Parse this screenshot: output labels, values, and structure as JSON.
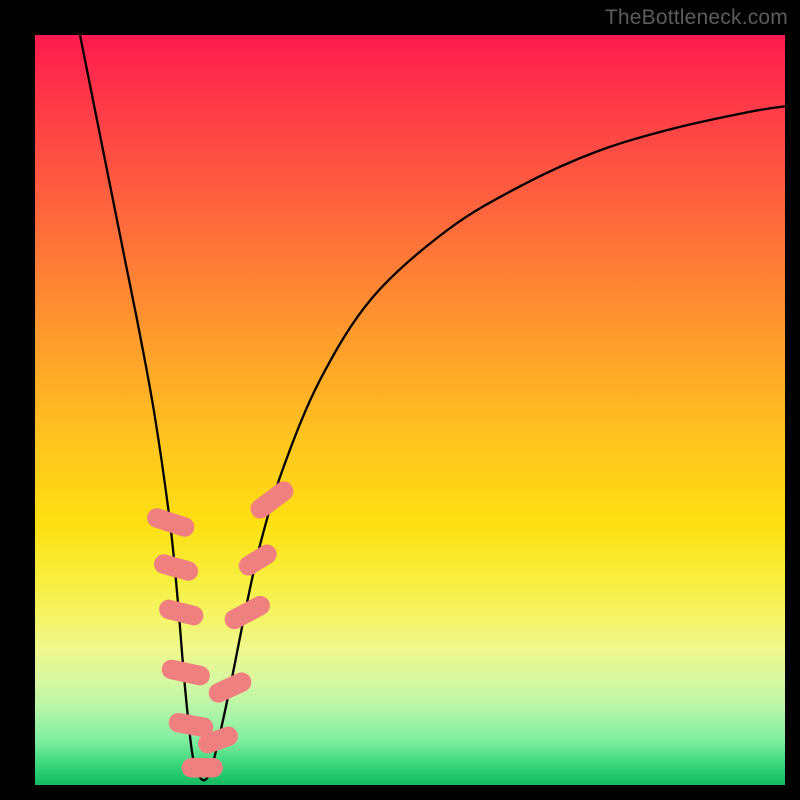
{
  "watermark": "TheBottleneck.com",
  "colors": {
    "background": "#000000",
    "curve": "#000000",
    "marker": "#f08080"
  },
  "chart_data": {
    "type": "line",
    "title": "",
    "xlabel": "",
    "ylabel": "",
    "xlim": [
      0,
      100
    ],
    "ylim": [
      0,
      100
    ],
    "series": [
      {
        "name": "bottleneck-curve",
        "x": [
          6,
          8,
          10,
          12,
          14,
          16,
          18,
          19,
          20,
          21,
          22,
          23,
          24,
          26,
          28,
          30,
          33,
          38,
          45,
          55,
          65,
          75,
          85,
          95,
          100
        ],
        "y": [
          100,
          90,
          80,
          70,
          60,
          49,
          35,
          25,
          13,
          4,
          1,
          1,
          4,
          13,
          23,
          32,
          42,
          54,
          65,
          74,
          80,
          84.5,
          87.5,
          89.7,
          90.5
        ]
      }
    ],
    "markers": [
      {
        "x": 18.1,
        "y": 35,
        "w": 2.6,
        "h": 6.5,
        "angle": -72
      },
      {
        "x": 18.8,
        "y": 29,
        "w": 2.6,
        "h": 6.0,
        "angle": -74
      },
      {
        "x": 19.5,
        "y": 23,
        "w": 2.6,
        "h": 6.0,
        "angle": -76
      },
      {
        "x": 20.1,
        "y": 15,
        "w": 2.6,
        "h": 6.5,
        "angle": -78
      },
      {
        "x": 20.8,
        "y": 8,
        "w": 2.6,
        "h": 6.0,
        "angle": -80
      },
      {
        "x": 22.3,
        "y": 2.3,
        "w": 5.5,
        "h": 2.6,
        "angle": 0
      },
      {
        "x": 24.4,
        "y": 6,
        "w": 2.6,
        "h": 5.5,
        "angle": 70
      },
      {
        "x": 26.0,
        "y": 13,
        "w": 2.6,
        "h": 6.0,
        "angle": 65
      },
      {
        "x": 28.3,
        "y": 23,
        "w": 2.6,
        "h": 6.5,
        "angle": 62
      },
      {
        "x": 29.7,
        "y": 30,
        "w": 2.6,
        "h": 5.5,
        "angle": 58
      },
      {
        "x": 31.6,
        "y": 38,
        "w": 2.6,
        "h": 6.5,
        "angle": 53
      }
    ]
  }
}
